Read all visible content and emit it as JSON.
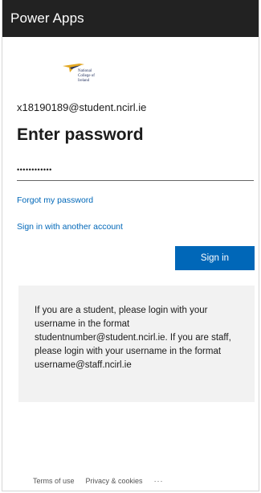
{
  "app": {
    "title": "Power Apps"
  },
  "logo": {
    "icon": "ncirl-logo-icon",
    "lines": [
      "National",
      "College of",
      "Ireland"
    ],
    "colors": {
      "gold": "#e3a823",
      "navy": "#1c2b5a"
    }
  },
  "signin": {
    "email": "x18190189@student.ncirl.ie",
    "heading": "Enter password",
    "password_value": "••••••••••••",
    "forgot_link": "Forgot my password",
    "other_account_link": "Sign in with another account",
    "button_label": "Sign in"
  },
  "info": {
    "message": "If you are a student, please login with your username in the format studentnumber@student.ncirl.ie. If you are staff, please login with your username in the format username@staff.ncirl.ie"
  },
  "footer": {
    "terms": "Terms of use",
    "privacy": "Privacy & cookies",
    "more": "···"
  },
  "colors": {
    "titlebar": "#222222",
    "accent": "#0067b8",
    "info_background": "#f2f2f2"
  }
}
